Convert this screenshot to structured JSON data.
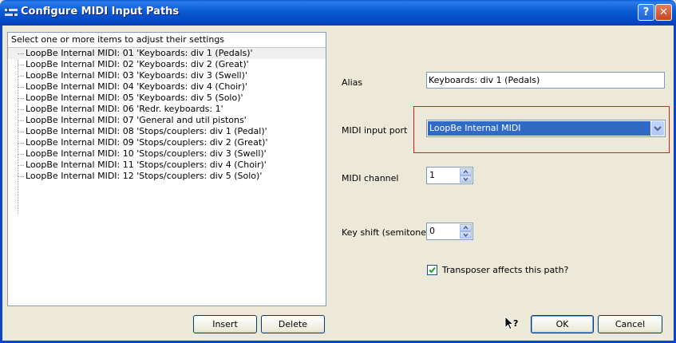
{
  "window": {
    "title": "Configure MIDI Input Paths",
    "help_glyph": "?",
    "close_glyph": "✕"
  },
  "paths_list": {
    "header": "Select one or more items to adjust their settings",
    "items": [
      "LoopBe Internal MIDI: 01 'Keyboards: div 1 (Pedals)'",
      "LoopBe Internal MIDI: 02 'Keyboards: div 2 (Great)'",
      "LoopBe Internal MIDI: 03 'Keyboards: div 3 (Swell)'",
      "LoopBe Internal MIDI: 04 'Keyboards: div 4 (Choir)'",
      "LoopBe Internal MIDI: 05 'Keyboards: div 5 (Solo)'",
      "LoopBe Internal MIDI: 06 'Redr. keyboards: 1'",
      "LoopBe Internal MIDI: 07 'General and util pistons'",
      "LoopBe Internal MIDI: 08 'Stops/couplers: div 1 (Pedal)'",
      "LoopBe Internal MIDI: 09 'Stops/couplers: div 2 (Great)'",
      "LoopBe Internal MIDI: 10 'Stops/couplers: div 3 (Swell)'",
      "LoopBe Internal MIDI: 11 'Stops/couplers: div 4 (Choir)'",
      "LoopBe Internal MIDI: 12 'Stops/couplers: div 5 (Solo)'"
    ]
  },
  "list_buttons": {
    "insert": "Insert",
    "delete": "Delete"
  },
  "settings": {
    "alias_label": "Alias",
    "alias_value": "Keyboards: div 1 (Pedals)",
    "port_label": "MIDI input port",
    "port_value": "LoopBe Internal MIDI",
    "channel_label": "MIDI channel",
    "channel_value": "1",
    "keyshift_label": "Key shift (semitones)",
    "keyshift_value": "0",
    "transposer_label": "Transposer affects this path?",
    "transposer_checked": true
  },
  "dialog_buttons": {
    "ok": "OK",
    "cancel": "Cancel"
  },
  "colors": {
    "titlebar": "#0a5ad4",
    "dialog_bg": "#ece9d8",
    "selection": "#316ac5",
    "highlight_border": "#cc2222"
  }
}
